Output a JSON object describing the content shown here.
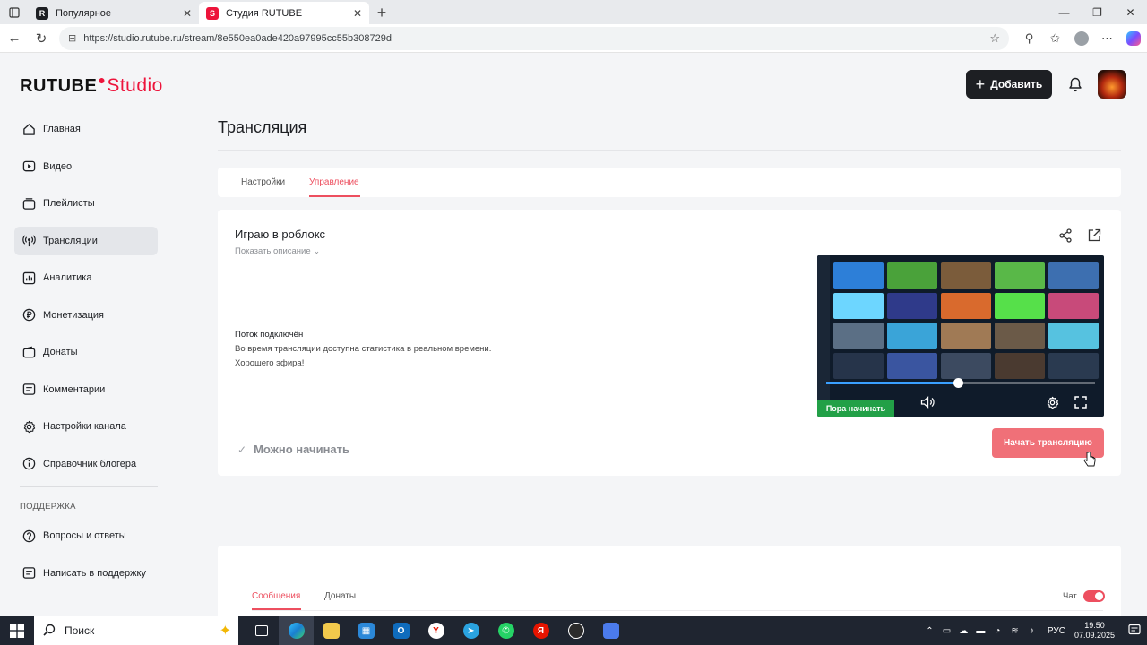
{
  "browser": {
    "tabs": [
      {
        "title": "Популярное",
        "active": false
      },
      {
        "title": "Студия RUTUBE",
        "active": true
      }
    ],
    "url": "https://studio.rutube.ru/stream/8e550ea0ade420a97995cc55b308729d"
  },
  "header": {
    "logo_main": "RUTUBE",
    "logo_studio": "Studio",
    "add_label": "Добавить"
  },
  "sidebar": {
    "items": [
      {
        "label": "Главная",
        "icon": "home-icon"
      },
      {
        "label": "Видео",
        "icon": "video-icon"
      },
      {
        "label": "Плейлисты",
        "icon": "playlist-icon"
      },
      {
        "label": "Трансляции",
        "icon": "broadcast-icon",
        "active": true
      },
      {
        "label": "Аналитика",
        "icon": "analytics-icon"
      },
      {
        "label": "Монетизация",
        "icon": "ruble-icon"
      },
      {
        "label": "Донаты",
        "icon": "wallet-icon"
      },
      {
        "label": "Комментарии",
        "icon": "comment-icon"
      },
      {
        "label": "Настройки канала",
        "icon": "gear-icon"
      },
      {
        "label": "Справочник блогера",
        "icon": "info-icon"
      }
    ],
    "support_heading": "ПОДДЕРЖКА",
    "support_items": [
      {
        "label": "Вопросы и ответы",
        "icon": "question-icon"
      },
      {
        "label": "Написать в поддержку",
        "icon": "chat-support-icon"
      }
    ]
  },
  "main": {
    "page_title": "Трансляция",
    "tabs": [
      {
        "label": "Настройки",
        "active": false
      },
      {
        "label": "Управление",
        "active": true
      }
    ],
    "stream": {
      "title": "Играю в роблокс",
      "show_description": "Показать описание",
      "status_title": "Поток подключён",
      "status_lines": [
        "Во время трансляции доступна статистика в реальном времени.",
        "Хорошего эфира!"
      ],
      "preview_badge": "Пора начинать",
      "preview_progress": 0.49,
      "ready_label": "Можно начинать",
      "start_button": "Начать трансляцию"
    },
    "chat": {
      "tabs": [
        {
          "label": "Сообщения",
          "active": true
        },
        {
          "label": "Донаты",
          "active": false
        }
      ],
      "chat_label": "Чат",
      "chat_enabled": true
    }
  },
  "taskbar": {
    "search_label": "Поиск",
    "language": "РУС",
    "time": "19:50",
    "date": "07.09.2025"
  },
  "colors": {
    "brand_red": "#ed143b",
    "accent_pink": "#ed4f5f",
    "start_button": "#f07078",
    "ready_badge_green": "#22a047",
    "help_fab": "#1f9e96"
  }
}
